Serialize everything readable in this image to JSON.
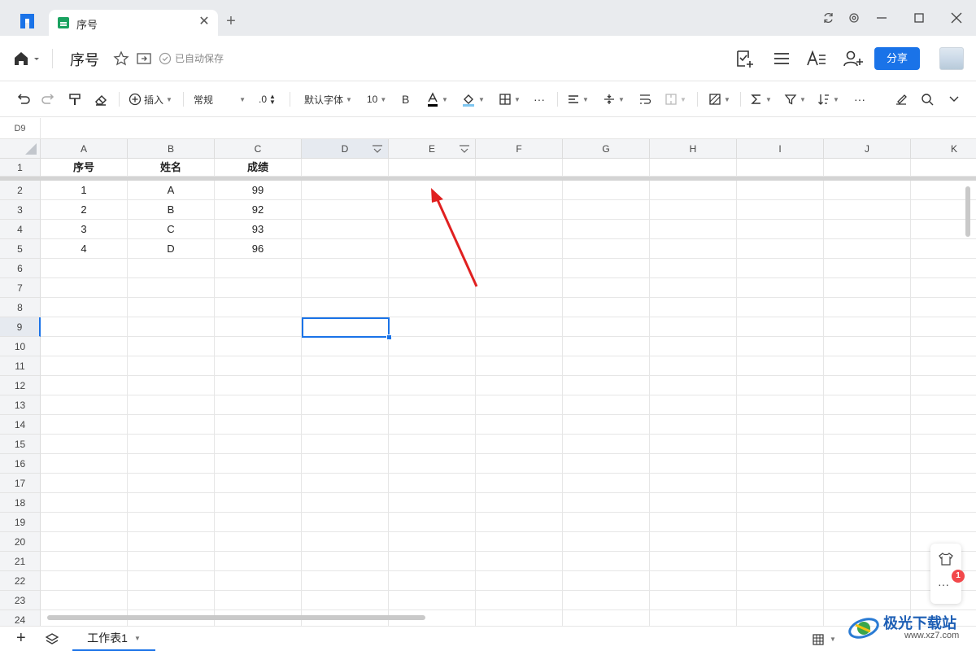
{
  "window": {
    "tab_title": "序号",
    "new_tab": "+",
    "close_tab": "✕"
  },
  "header": {
    "doc_title": "序号",
    "save_status": "已自动保存",
    "share_label": "分享"
  },
  "toolbar": {
    "insert_label": "插入",
    "format_label": "常规",
    "decimal_label": ".0",
    "font_label": "默认字体",
    "font_size": "10",
    "bold_label": "B",
    "more_label": "···"
  },
  "formula_bar": {
    "cell_ref": "D9"
  },
  "grid": {
    "columns": [
      "A",
      "B",
      "C",
      "D",
      "E",
      "F",
      "G",
      "H",
      "I",
      "J",
      "K"
    ],
    "rows": [
      "1",
      "2",
      "3",
      "4",
      "5",
      "6",
      "7",
      "8",
      "9",
      "10",
      "11",
      "12",
      "13",
      "14",
      "15",
      "16",
      "17",
      "18",
      "19",
      "20",
      "21",
      "22",
      "23",
      "24"
    ],
    "headers": [
      "序号",
      "姓名",
      "成绩"
    ],
    "data": [
      [
        "1",
        "A",
        "99"
      ],
      [
        "2",
        "B",
        "92"
      ],
      [
        "3",
        "C",
        "93"
      ],
      [
        "4",
        "D",
        "96"
      ]
    ],
    "selected_cell": "D9"
  },
  "bottom": {
    "sheet_tab": "工作表1",
    "add_sheet": "+"
  },
  "float_panel": {
    "badge_count": "1",
    "more_label": "···"
  },
  "watermark": {
    "text": "极光下载站",
    "sub": "www.xz7.com"
  },
  "colors": {
    "accent": "#1a73e8",
    "sheet_green": "#1aa260",
    "badge_red": "#f2484b",
    "arrow_red": "#e02020"
  }
}
